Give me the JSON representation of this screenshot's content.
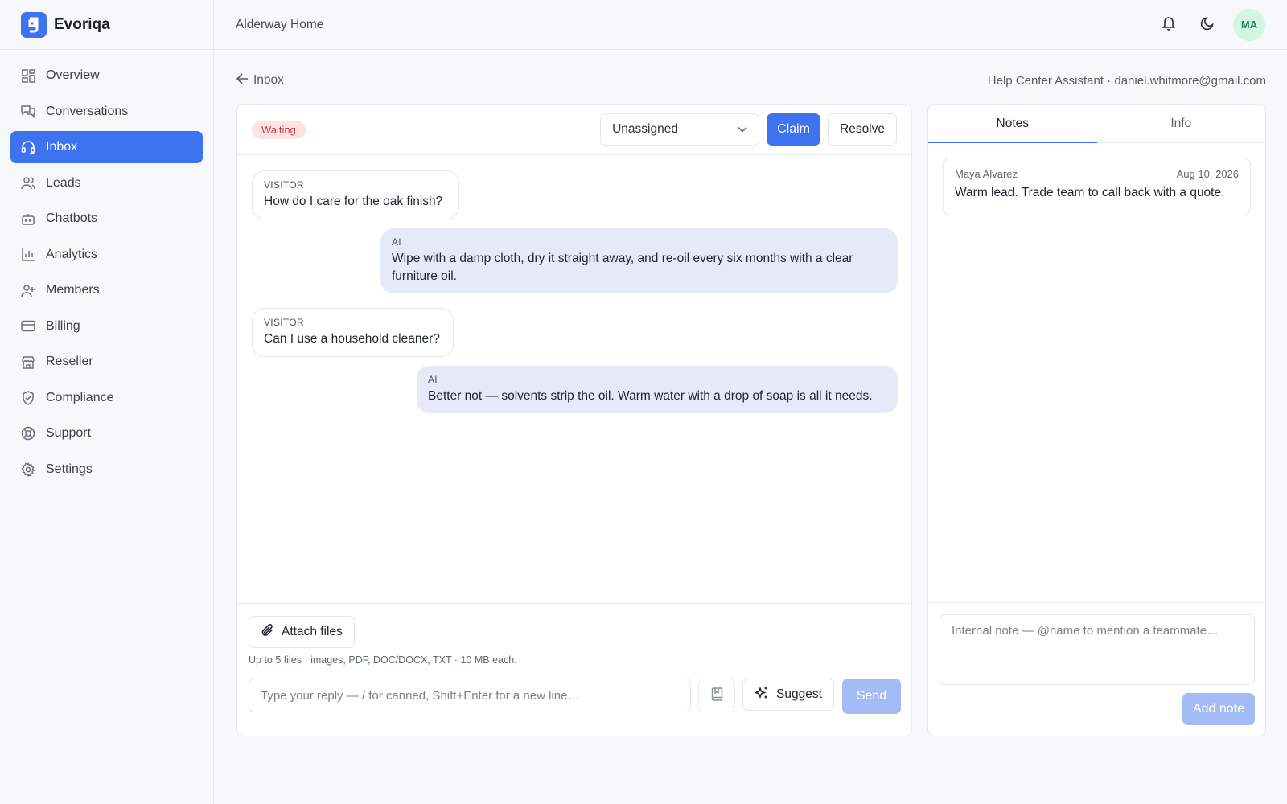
{
  "brand": {
    "name": "Evoriqa",
    "accent": "#3d73f0"
  },
  "header": {
    "workspace": "Alderway Home",
    "avatar_initials": "MA",
    "icons": [
      "bell-icon",
      "moon-icon"
    ]
  },
  "sidebar": {
    "items": [
      {
        "label": "Overview",
        "icon": "grid-icon"
      },
      {
        "label": "Conversations",
        "icon": "chat-icon"
      },
      {
        "label": "Inbox",
        "icon": "headset-icon",
        "active": true
      },
      {
        "label": "Leads",
        "icon": "users-icon"
      },
      {
        "label": "Chatbots",
        "icon": "bot-icon"
      },
      {
        "label": "Analytics",
        "icon": "chart-icon"
      },
      {
        "label": "Members",
        "icon": "user-plus-icon"
      },
      {
        "label": "Billing",
        "icon": "card-icon"
      },
      {
        "label": "Reseller",
        "icon": "store-icon"
      },
      {
        "label": "Compliance",
        "icon": "shield-icon"
      },
      {
        "label": "Support",
        "icon": "lifebuoy-icon"
      },
      {
        "label": "Settings",
        "icon": "gear-icon"
      }
    ]
  },
  "breadcrumb": {
    "back_label": "Inbox",
    "assistant": "Help Center Assistant · daniel.whitmore@gmail.com"
  },
  "conversation": {
    "status": "Waiting",
    "assignee": "Unassigned",
    "claim_label": "Claim",
    "resolve_label": "Resolve",
    "messages": [
      {
        "sender": "VISITOR",
        "text": "How do I care for the oak finish?"
      },
      {
        "sender": "AI",
        "text": "Wipe with a damp cloth, dry it straight away, and re-oil every six months with a clear furniture oil."
      },
      {
        "sender": "VISITOR",
        "text": "Can I use a household cleaner?"
      },
      {
        "sender": "AI",
        "text": "Better not — solvents strip the oil. Warm water with a drop of soap is all it needs."
      }
    ]
  },
  "composer": {
    "attach_label": "Attach files",
    "attach_hint": "Up to 5 files · images, PDF, DOC/DOCX, TXT · 10 MB each.",
    "placeholder": "Type your reply — / for canned, Shift+Enter for a new line…",
    "suggest_label": "Suggest",
    "send_label": "Send"
  },
  "notes_panel": {
    "tabs": [
      "Notes",
      "Info"
    ],
    "notes": [
      {
        "author": "Maya Alvarez",
        "date": "Aug 10, 2026",
        "text": "Warm lead. Trade team to call back with a quote."
      }
    ],
    "placeholder": "Internal note — @name to mention a teammate…",
    "add_label": "Add note"
  }
}
